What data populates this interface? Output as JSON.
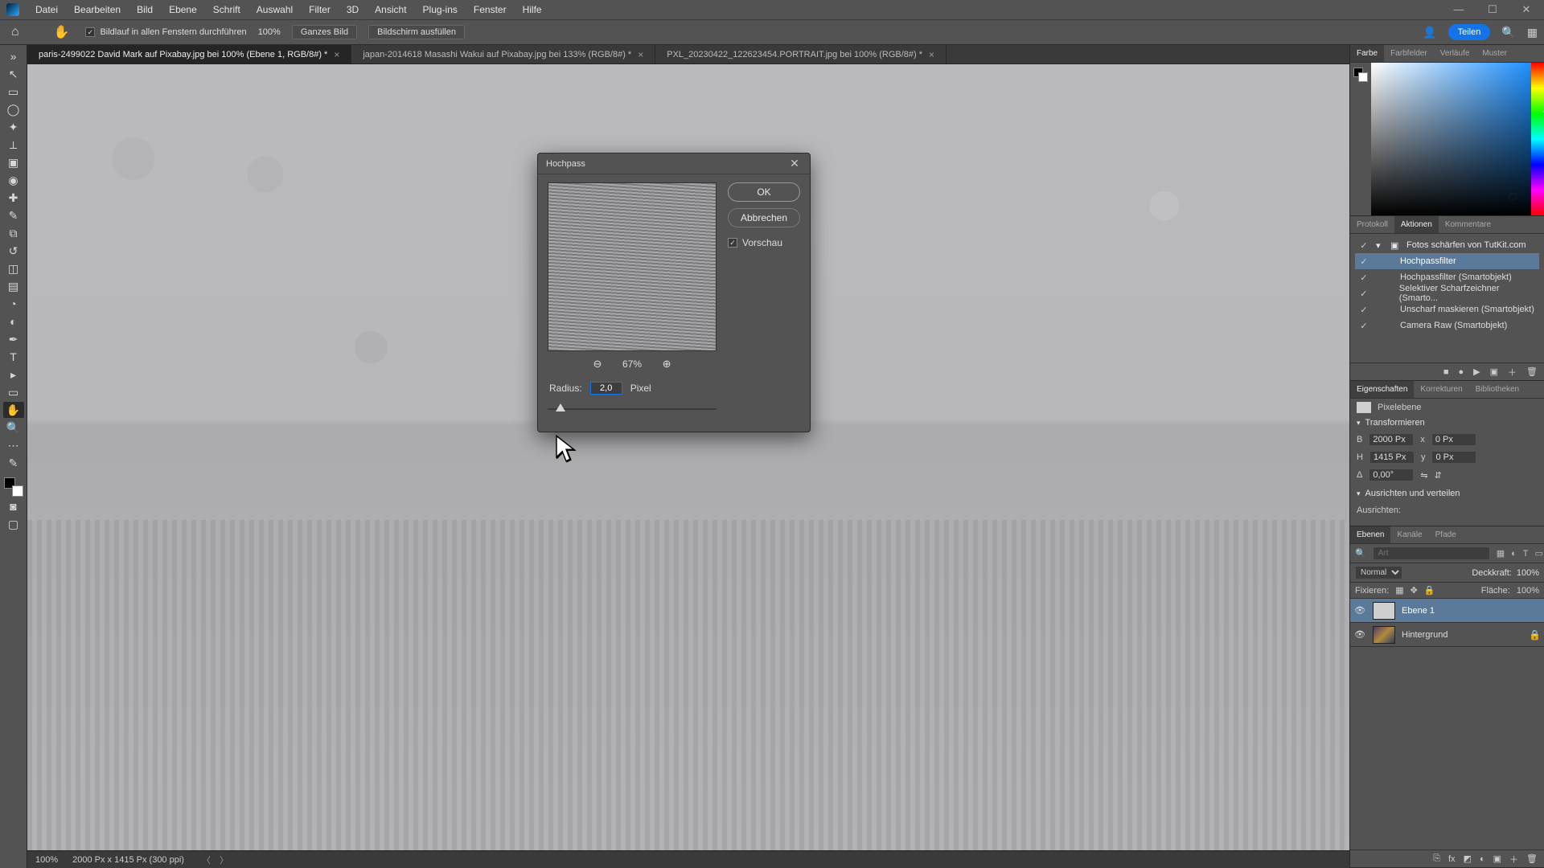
{
  "menu": [
    "Datei",
    "Bearbeiten",
    "Bild",
    "Ebene",
    "Schrift",
    "Auswahl",
    "Filter",
    "3D",
    "Ansicht",
    "Plug-ins",
    "Fenster",
    "Hilfe"
  ],
  "options_bar": {
    "scroll_all_label": "Bildlauf in allen Fenstern durchführen",
    "zoom_value": "100%",
    "fit_label": "Ganzes Bild",
    "fill_label": "Bildschirm ausfüllen",
    "share_label": "Teilen"
  },
  "tabs": [
    {
      "label": "paris-2499022  David Mark auf Pixabay.jpg bei 100% (Ebene 1, RGB/8#) *",
      "active": true
    },
    {
      "label": "japan-2014618 Masashi Wakui auf Pixabay.jpg bei 133% (RGB/8#) *",
      "active": false
    },
    {
      "label": "PXL_20230422_122623454.PORTRAIT.jpg bei 100% (RGB/8#) *",
      "active": false
    }
  ],
  "statusbar": {
    "zoom": "100%",
    "info": "2000 Px x 1415 Px (300 ppi)"
  },
  "dialog": {
    "title": "Hochpass",
    "ok": "OK",
    "cancel": "Abbrechen",
    "preview_label": "Vorschau",
    "zoom_percent": "67%",
    "radius_label": "Radius:",
    "radius_value": "2,0",
    "pixel_label": "Pixel"
  },
  "panels": {
    "color": {
      "tabs": [
        "Farbe",
        "Farbfelder",
        "Verläufe",
        "Muster"
      ]
    },
    "history": {
      "tabs": [
        "Protokoll",
        "Aktionen",
        "Kommentare"
      ],
      "set_label": "Fotos schärfen von TutKit.com",
      "items": [
        "Hochpassfilter",
        "Hochpassfilter (Smartobjekt)",
        "Selektiver Scharfzeichner (Smarto...",
        "Unscharf maskieren (Smartobjekt)",
        "Camera Raw (Smartobjekt)"
      ]
    },
    "properties": {
      "tabs": [
        "Eigenschaften",
        "Korrekturen",
        "Bibliotheken"
      ],
      "pixel_layer": "Pixelebene",
      "transform": "Transformieren",
      "w_label": "B",
      "w_value": "2000 Px",
      "h_label": "H",
      "h_value": "1415 Px",
      "x_label": "x",
      "x_value": "0 Px",
      "y_label": "y",
      "y_value": "0 Px",
      "angle_label": "Δ",
      "angle_value": "0,00°",
      "align_section": "Ausrichten und verteilen",
      "align_label": "Ausrichten:"
    },
    "layers": {
      "tabs": [
        "Ebenen",
        "Kanäle",
        "Pfade"
      ],
      "search_placeholder": "Art",
      "blend_label": "Normal",
      "opacity_label": "Deckkraft:",
      "opacity_value": "100%",
      "lock_label": "Fixieren:",
      "fill_label": "Fläche:",
      "fill_value": "100%",
      "items": [
        {
          "name": "Ebene 1",
          "selected": true,
          "locked": false,
          "bg": false
        },
        {
          "name": "Hintergrund",
          "selected": false,
          "locked": true,
          "bg": true
        }
      ]
    }
  },
  "tools": [
    {
      "name": "move-tool",
      "glyph": "↖"
    },
    {
      "name": "marquee-tool",
      "glyph": "▭"
    },
    {
      "name": "lasso-tool",
      "glyph": "◯"
    },
    {
      "name": "quick-select-tool",
      "glyph": "✦"
    },
    {
      "name": "crop-tool",
      "glyph": "⟂"
    },
    {
      "name": "frame-tool",
      "glyph": "▣"
    },
    {
      "name": "eyedropper-tool",
      "glyph": "◉"
    },
    {
      "name": "healing-tool",
      "glyph": "✚"
    },
    {
      "name": "brush-tool",
      "glyph": "✎"
    },
    {
      "name": "stamp-tool",
      "glyph": "⧉"
    },
    {
      "name": "history-brush-tool",
      "glyph": "↺"
    },
    {
      "name": "eraser-tool",
      "glyph": "◫"
    },
    {
      "name": "gradient-tool",
      "glyph": "▤"
    },
    {
      "name": "blur-tool",
      "glyph": "◔"
    },
    {
      "name": "dodge-tool",
      "glyph": "◐"
    },
    {
      "name": "pen-tool",
      "glyph": "✒"
    },
    {
      "name": "type-tool",
      "glyph": "T"
    },
    {
      "name": "path-select-tool",
      "glyph": "▸"
    },
    {
      "name": "shape-tool",
      "glyph": "▭"
    },
    {
      "name": "hand-tool",
      "glyph": "✋",
      "active": true
    },
    {
      "name": "zoom-tool",
      "glyph": "🔍"
    },
    {
      "name": "more-tool",
      "glyph": "⋯"
    },
    {
      "name": "edit-toolbar",
      "glyph": "✎"
    }
  ]
}
